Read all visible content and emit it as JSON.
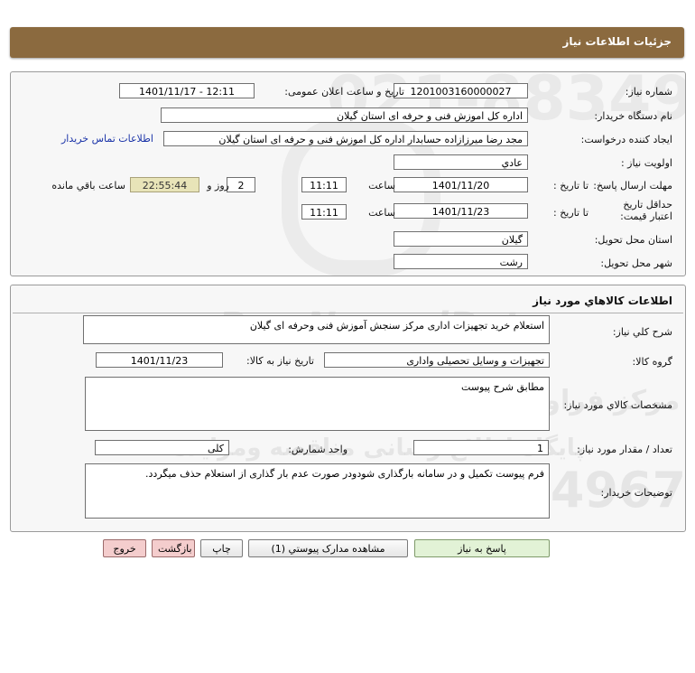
{
  "header": {
    "title": "جزئيات اطلاعات نياز"
  },
  "info": {
    "need_number_label": "شماره نياز:",
    "need_number": "1201003160000027",
    "announce_label": "تاريخ و ساعت اعلان عمومی:",
    "announce_value": "1401/11/17 - 12:11",
    "buyer_label": "نام دستگاه خريدار:",
    "buyer": "اداره کل اموزش فنی و حرفه ای استان گیلان",
    "creator_label": "ايجاد کننده درخواست:",
    "creator": "مجد رضا میرزازاده حسابدار اداره کل اموزش فنی و حرفه ای استان گیلان",
    "contact_link": "اطلاعات تماس خريدار",
    "priority_label": "اولويت نياز :",
    "priority": "عادي",
    "deadline_label": "مهلت ارسال پاسخ:",
    "until_date_label": "تا تاريخ :",
    "deadline_date": "1401/11/20",
    "time_label": "ساعت",
    "deadline_time": "11:11",
    "days": "2",
    "days_label": "روز و",
    "remaining": "22:55:44",
    "remaining_label": "ساعت باقي مانده",
    "validity_label": "حداقل تاريخ اعتبار قيمت:",
    "validity_until_label": "تا تاريخ :",
    "validity_date": "1401/11/23",
    "validity_time_label": "ساعت",
    "validity_time": "11:11",
    "province_label": "استان محل تحويل:",
    "province": "گيلان",
    "city_label": "شهر محل تحويل:",
    "city": "رشت"
  },
  "goods": {
    "title": "اطلاعات کالاهاي مورد نياز",
    "desc_label": "شرح کلي نياز:",
    "desc": "استعلام  خرید تجهیزات اداری مرکز سنجش آموزش فنی وحرفه ای گیلان",
    "group_label": "گروه کالا:",
    "group": "تجهيزات و وسايل تحصيلی واداری",
    "need_date_label": "تاريخ نياز به کالا:",
    "need_date": "1401/11/23",
    "specs_label": "مشخصات کالاي مورد نياز:",
    "specs": "مطابق شرح پیوست",
    "qty_label": "تعداد / مقدار مورد نياز:",
    "qty": "1",
    "unit_label": "واحد شمارش:",
    "unit": "کلی",
    "notes_label": "توضيحات خريدار:",
    "notes": "فرم پیوست تکمیل و در سامانه بارگذاری شودودر صورت عدم بار گذاری از استعلام حذف میگردد."
  },
  "buttons": {
    "reply": "پاسخ به نياز",
    "attachments": "مشاهده مدارک پيوستي (1)",
    "print": "چاپ",
    "back": "بازگشت",
    "exit": "خروج"
  },
  "watermark": {
    "brand": "ParsNamadData",
    "fa_line1": "مرکز فراوری اطلاعات پارس نماد داده ها",
    "fa_line2": "پایگاه اطلاع رسانی مناقصه ومزایده",
    "phone": "021-88349670"
  }
}
